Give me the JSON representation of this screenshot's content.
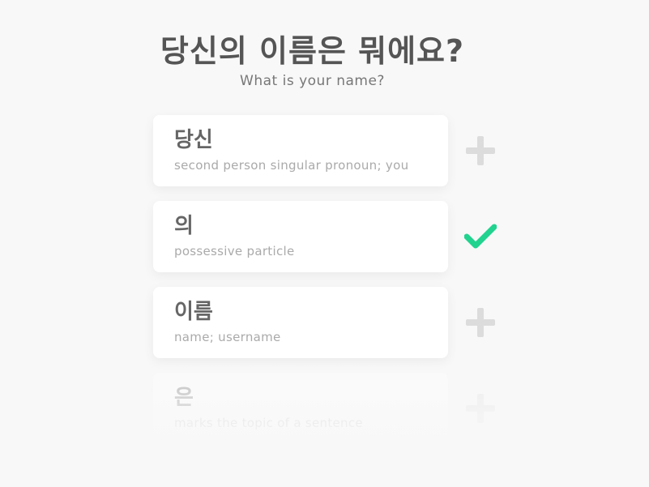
{
  "header": {
    "title": "당신의 이름은 뭐에요?",
    "subtitle": "What is your name?"
  },
  "words": [
    {
      "word": "당신",
      "definition": "second person singular pronoun; you",
      "action": "plus-icon"
    },
    {
      "word": "의",
      "definition": "possessive particle",
      "action": "checkmark-icon"
    },
    {
      "word": "이름",
      "definition": "name; username",
      "action": "plus-icon"
    },
    {
      "word": "은",
      "definition": "marks the topic of a sentence",
      "action": "plus-icon"
    }
  ],
  "colors": {
    "accent_check": "#21d38f",
    "plus": "#dcdcdc",
    "background": "#f8f8f8"
  }
}
